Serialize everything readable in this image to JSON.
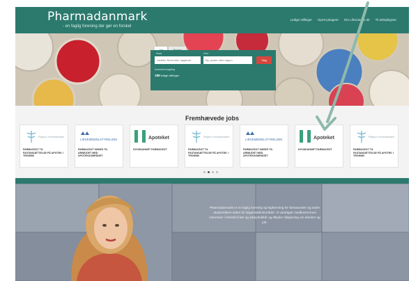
{
  "header": {
    "brand": "Pharmadanmark",
    "tagline": "- en faglig forening der gør en forskel",
    "nav": [
      "Ledige stillinger",
      "Opret jobagent",
      "Om Lifescience.dk",
      "Til arbejdsgiver"
    ]
  },
  "search": {
    "tabs": [
      "Job",
      "Region"
    ],
    "label_what": "Hvad",
    "label_where": "Hvor",
    "input_what_placeholder": "Jobtitel, firma eller nøgleord",
    "input_where_placeholder": "By, postnr eller region",
    "button": "Søg",
    "advanced": "Avanceret søgning",
    "count": "188",
    "count_suffix": "ledige stillinger"
  },
  "featured": {
    "title": "Fremhævede jobs",
    "cards": [
      {
        "logo": "Region Hovedstaden",
        "logo_type": "caduceus",
        "title": "FARMACEUT TIL FASTANSÆTTELSE PÅ APOTEK I TROMSØ"
      },
      {
        "logo": "LÆGEMIDDELSTYRELSEN",
        "logo_type": "crown",
        "title": "FARMACEUT SØGES TIL ARBEJDET MED APOTEKSOMRÅDET"
      },
      {
        "logo": "Apoteket",
        "logo_type": "apoteket",
        "title": "NYUDDANNET FARMACEUT"
      },
      {
        "logo": "Region Hovedstaden",
        "logo_type": "caduceus",
        "title": "FARMACEUT TIL FASTANSÆTTELSE PÅ APOTEK I TROMSØ"
      },
      {
        "logo": "LÆGEMIDDELSTYRELSEN",
        "logo_type": "crown",
        "title": "FARMACEUT SØGES TIL ARBEJDET MED APOTEKSOMRÅDET"
      },
      {
        "logo": "Apoteket",
        "logo_type": "apoteket",
        "title": "NYUDDANNET FARMACEUT"
      },
      {
        "logo": "Region Hovedstaden",
        "logo_type": "caduceus",
        "title": "FARMACEUT TIL FASTANSÆTTELSE PÅ APOTEK I TROMSØ"
      }
    ]
  },
  "info": {
    "text": "Pharmadanmark er en faglig forening og fagforening for farmaceuter og andre akademikere inden for lægemiddelområdet. Vi varetager medlemmernes interesser i forhold til løn og arbejdsvilkår og tilbyder rådgivning om karriere og job."
  },
  "colors": {
    "brand": "#2c7a6e",
    "accent": "#d9453c",
    "arrow": "#8fb9ab"
  }
}
